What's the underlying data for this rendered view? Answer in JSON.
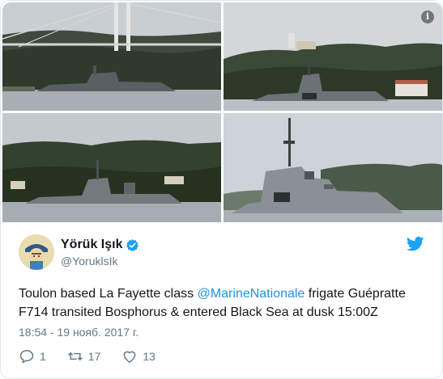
{
  "media": {
    "photos": [
      {
        "alt": "photo-1"
      },
      {
        "alt": "photo-2"
      },
      {
        "alt": "photo-3"
      },
      {
        "alt": "photo-4"
      }
    ],
    "info_icon": "i"
  },
  "tweet": {
    "display_name": "Yörük Işık",
    "handle": "@YoruklsIk",
    "text_before": "Toulon based La Fayette class ",
    "mention": "@MarineNationale",
    "text_after": " frigate Guépratte F714 transited Bosphorus & entered Black Sea at dusk 15:00Z",
    "timestamp": "18:54 - 19 нояб. 2017 г.",
    "replies": "1",
    "retweets": "17",
    "likes": "13"
  },
  "colors": {
    "link": "#1b95e0",
    "verified": "#1da1f2",
    "muted": "#657786",
    "text": "#14171a"
  },
  "icons": [
    "info-icon",
    "verified-icon",
    "twitter-bird-icon",
    "reply-icon",
    "retweet-icon",
    "like-icon"
  ]
}
